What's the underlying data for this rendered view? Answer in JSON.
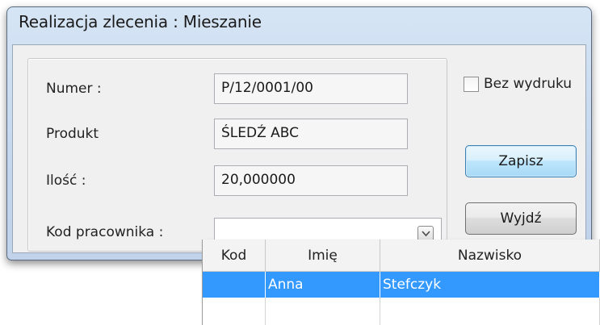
{
  "window": {
    "title": "Realizacja zlecenia : Mieszanie"
  },
  "form": {
    "numer_label": "Numer :",
    "numer_value": "P/12/0001/00",
    "produkt_label": "Produkt",
    "produkt_value": "ŚLEDŹ ABC",
    "ilosc_label": "Ilość :",
    "ilosc_value": "20,000000",
    "kod_label": "Kod pracownika :",
    "kod_value": ""
  },
  "options": {
    "bez_wydruku_label": "Bez wydruku",
    "bez_wydruku_checked": false
  },
  "buttons": {
    "zapisz": "Zapisz",
    "wyjdz": "Wyjdź"
  },
  "dropdown": {
    "columns": [
      "Kod",
      "Imię",
      "Nazwisko"
    ],
    "rows": [
      {
        "kod": "",
        "imie": "Anna",
        "nazwisko": "Stefczyk"
      }
    ],
    "selected_color": "#3399ff"
  },
  "icons": {
    "combo_button": "chevron-down-icon"
  }
}
